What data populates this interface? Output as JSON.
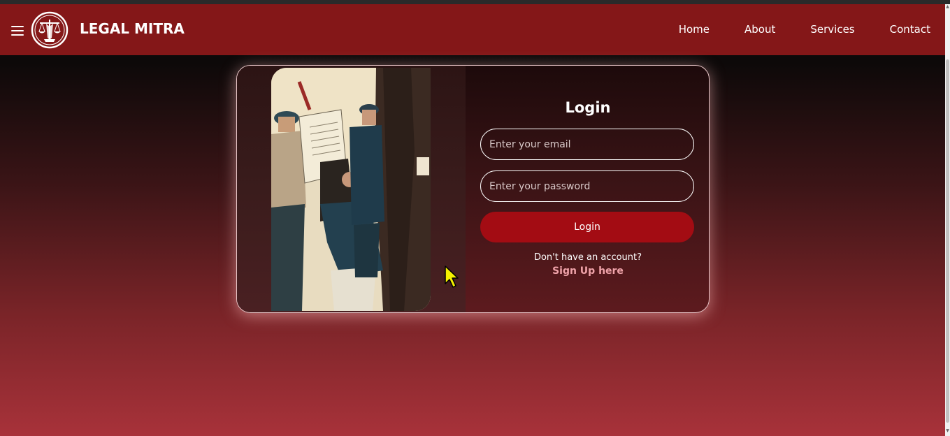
{
  "brand": {
    "name": "LEGAL MITRA",
    "logo_icon": "scales-of-justice-icon"
  },
  "nav": {
    "menu_icon": "hamburger-menu-icon",
    "links": [
      "Home",
      "About",
      "Services",
      "Contact"
    ]
  },
  "login": {
    "title": "Login",
    "email_placeholder": "Enter your email",
    "password_placeholder": "Enter your password",
    "button_label": "Login",
    "no_account_text": "Don't have an account?",
    "signup_link": "Sign Up here"
  },
  "colors": {
    "navbar": "#841718",
    "button": "#a30c13",
    "signup_link": "#f0a3aa"
  }
}
